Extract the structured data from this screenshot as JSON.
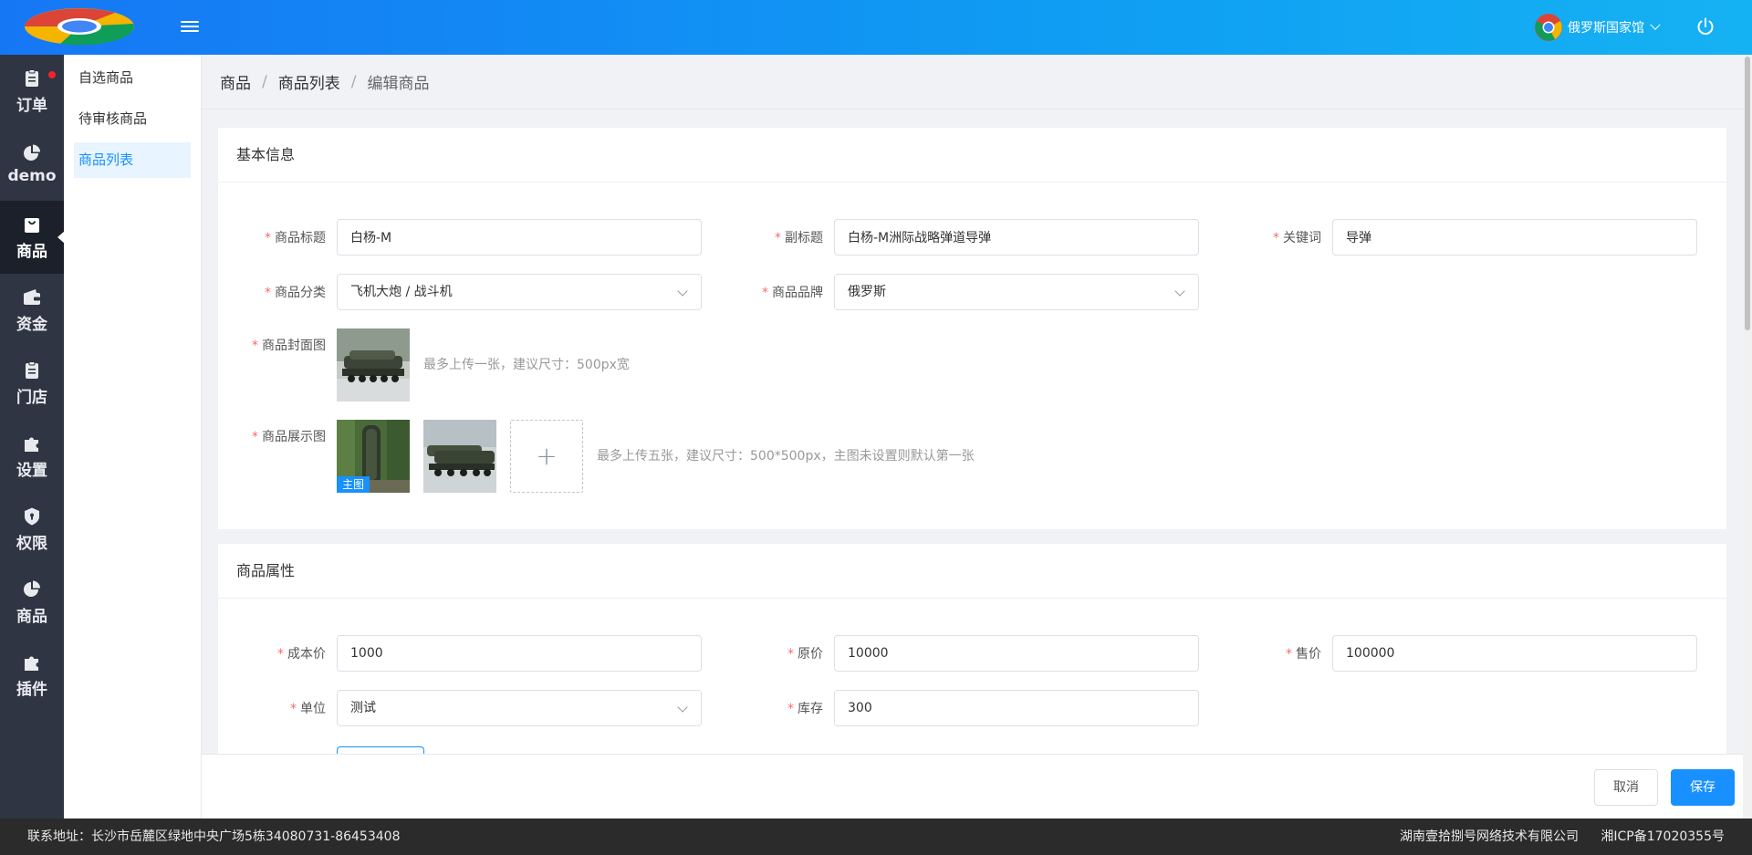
{
  "header": {
    "user_name": "俄罗斯国家馆"
  },
  "nav": {
    "items": [
      {
        "label": "订单"
      },
      {
        "label": "demo"
      },
      {
        "label": "商品"
      },
      {
        "label": "资金"
      },
      {
        "label": "门店"
      },
      {
        "label": "设置"
      },
      {
        "label": "权限"
      },
      {
        "label": "商品"
      },
      {
        "label": "插件"
      }
    ]
  },
  "submenu": {
    "items": [
      {
        "label": "自选商品"
      },
      {
        "label": "待审核商品"
      },
      {
        "label": "商品列表"
      }
    ]
  },
  "breadcrumb": {
    "items": [
      "商品",
      "商品列表",
      "编辑商品"
    ],
    "separator": "/"
  },
  "basic": {
    "title": "基本信息",
    "required_mark": "*",
    "product_title": {
      "label": "商品标题",
      "value": "白杨-M"
    },
    "subtitle": {
      "label": "副标题",
      "value": "白杨-M洲际战略弹道导弹"
    },
    "keywords": {
      "label": "关键词",
      "value": "导弹"
    },
    "category": {
      "label": "商品分类",
      "value": "飞机大炮 / 战斗机"
    },
    "brand": {
      "label": "商品品牌",
      "value": "俄罗斯"
    },
    "cover": {
      "label": "商品封面图",
      "hint": "最多上传一张，建议尺寸：500px宽"
    },
    "gallery": {
      "label": "商品展示图",
      "main_badge": "主图",
      "add_symbol": "+",
      "hint": "最多上传五张，建议尺寸：500*500px，主图未设置则默认第一张"
    }
  },
  "attributes": {
    "title": "商品属性",
    "cost_price": {
      "label": "成本价",
      "value": "1000"
    },
    "original_price": {
      "label": "原价",
      "value": "10000"
    },
    "sale_price": {
      "label": "售价",
      "value": "100000"
    },
    "unit": {
      "label": "单位",
      "value": "测试"
    },
    "stock": {
      "label": "库存",
      "value": "300"
    }
  },
  "actions": {
    "cancel": "取消",
    "save": "保存"
  },
  "footer": {
    "address": "联系地址：长沙市岳麓区绿地中央广场5栋34080731-86453408",
    "company": "湖南壹拾捌号网络技术有限公司",
    "icp": "湘ICP备17020355号"
  },
  "colors": {
    "primary": "#1890ff",
    "required": "#f56c6c",
    "nav_bg": "#2f3542"
  }
}
